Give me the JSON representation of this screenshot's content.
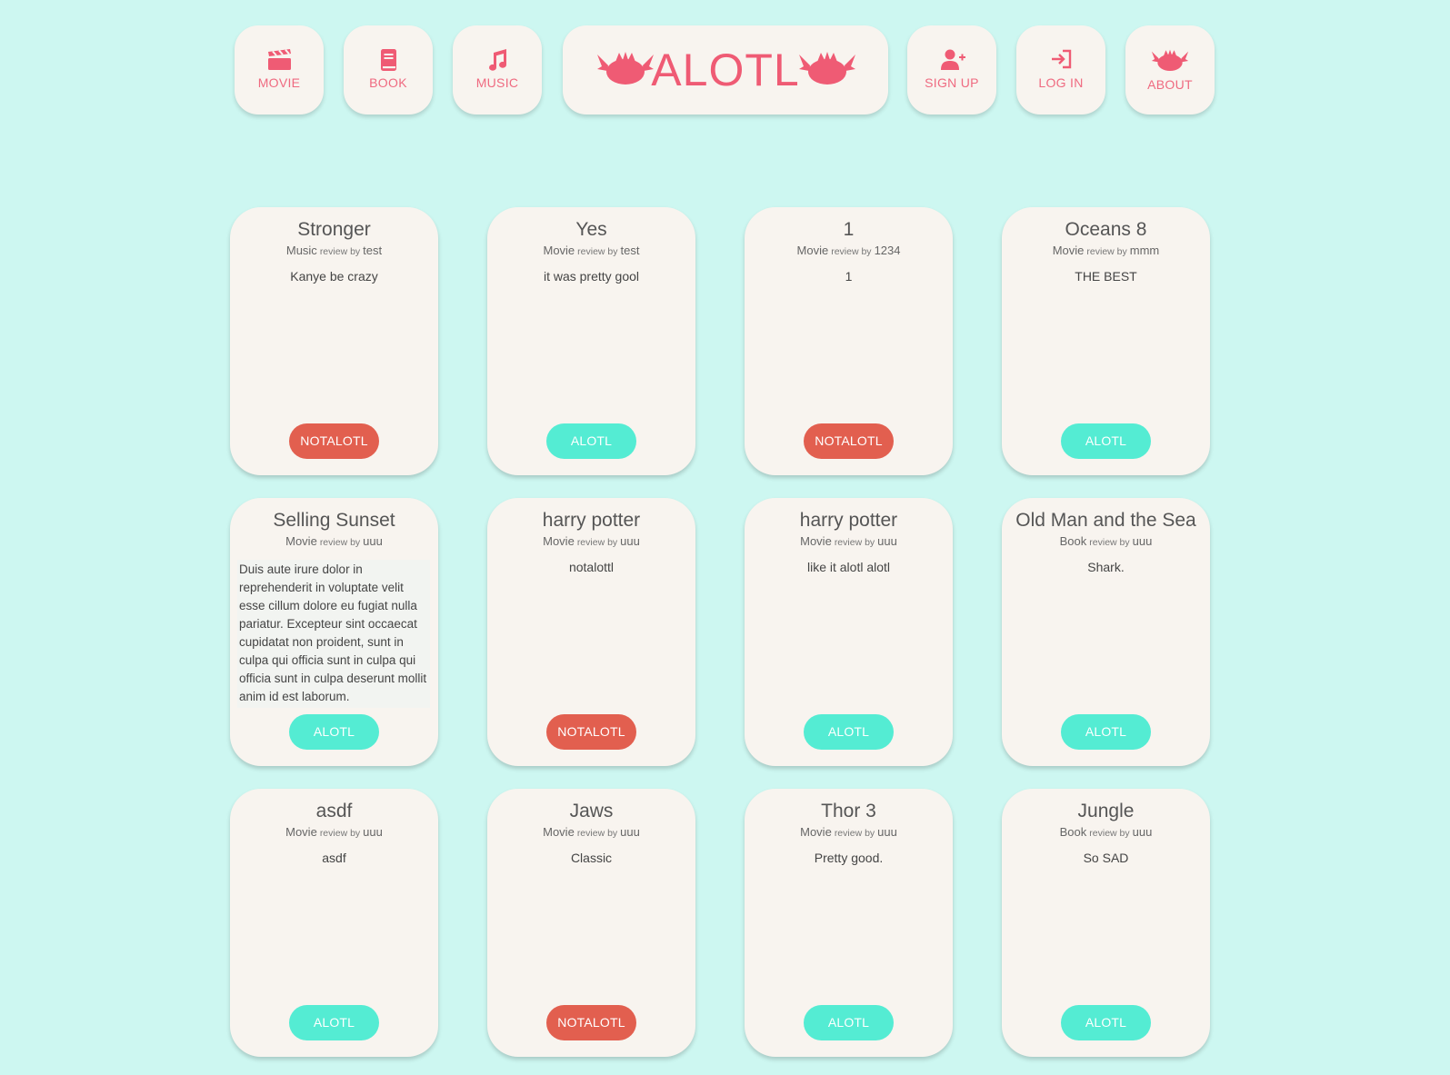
{
  "nav": {
    "movie_label": "MOVIE",
    "book_label": "BOOK",
    "music_label": "MUSIC",
    "logo_text": "ALOTL",
    "signup_label": "SIGN UP",
    "login_label": "LOG IN",
    "about_label": "ABOUT"
  },
  "colors": {
    "background": "#cdf7f1",
    "card": "#f8f4ef",
    "brand_pink": "#ef5b74",
    "alotl_button": "#54ecd3",
    "notalotl_button": "#e25f4f"
  },
  "review_by_label": "review by",
  "cards": [
    {
      "title": "Stronger",
      "category": "Music",
      "author": "test",
      "body": "Kanye be crazy",
      "vote": "NOTALOTL"
    },
    {
      "title": "Yes",
      "category": "Movie",
      "author": "test",
      "body": "it was pretty gool",
      "vote": "ALOTL"
    },
    {
      "title": "1",
      "category": "Movie",
      "author": "1234",
      "body": "1",
      "vote": "NOTALOTL"
    },
    {
      "title": "Oceans 8",
      "category": "Movie",
      "author": "mmm",
      "body": "THE BEST",
      "vote": "ALOTL"
    },
    {
      "title": "Selling Sunset",
      "category": "Movie",
      "author": "uuu",
      "body": "Duis aute irure dolor in reprehenderit in voluptate velit esse cillum dolore eu fugiat nulla pariatur. Excepteur sint occaecat cupidatat non proident, sunt in culpa qui officia sunt in culpa qui officia sunt in culpa deserunt mollit anim id est laborum.",
      "vote": "ALOTL"
    },
    {
      "title": "harry potter",
      "category": "Movie",
      "author": "uuu",
      "body": "notalottl",
      "vote": "NOTALOTL"
    },
    {
      "title": "harry potter",
      "category": "Movie",
      "author": "uuu",
      "body": "like it alotl alotl",
      "vote": "ALOTL"
    },
    {
      "title": "Old Man and the Sea",
      "category": "Book",
      "author": "uuu",
      "body": "Shark.",
      "vote": "ALOTL"
    },
    {
      "title": "asdf",
      "category": "Movie",
      "author": "uuu",
      "body": "asdf",
      "vote": "ALOTL"
    },
    {
      "title": "Jaws",
      "category": "Movie",
      "author": "uuu",
      "body": "Classic",
      "vote": "NOTALOTL"
    },
    {
      "title": "Thor 3",
      "category": "Movie",
      "author": "uuu",
      "body": "Pretty good.",
      "vote": "ALOTL"
    },
    {
      "title": "Jungle",
      "category": "Book",
      "author": "uuu",
      "body": "So SAD",
      "vote": "ALOTL"
    }
  ]
}
